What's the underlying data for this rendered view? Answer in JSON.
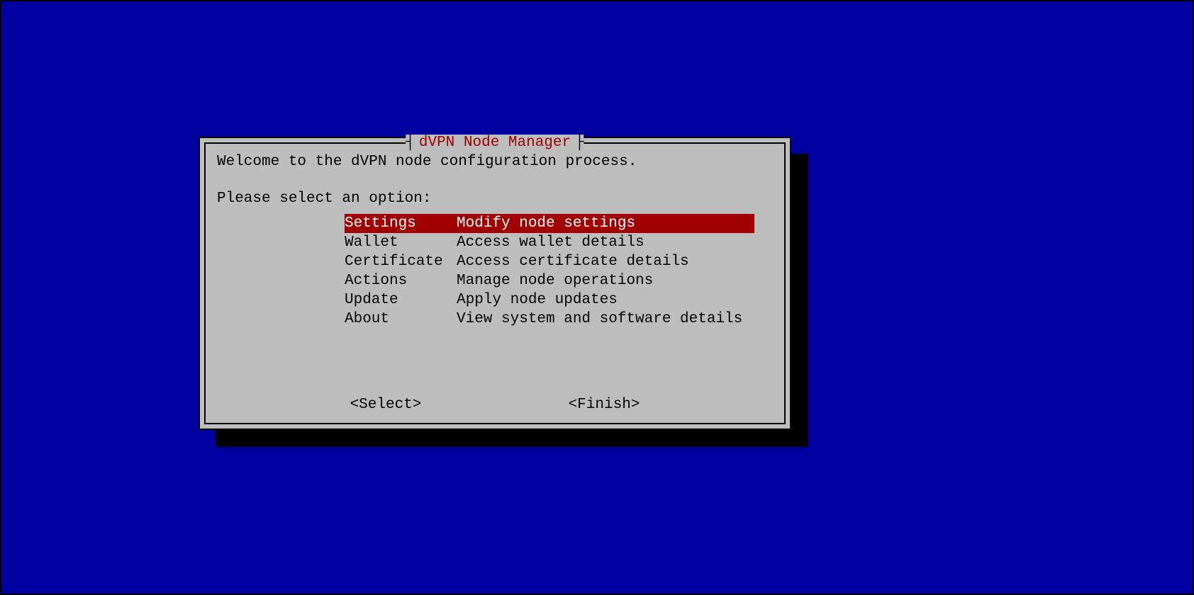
{
  "dialog": {
    "title": "dVPN Node Manager",
    "welcome": "Welcome to the dVPN node configuration process.",
    "prompt": "Please select an option:",
    "menu": [
      {
        "key": "Settings",
        "desc": "Modify node settings",
        "selected": true
      },
      {
        "key": "Wallet",
        "desc": "Access wallet details",
        "selected": false
      },
      {
        "key": "Certificate",
        "desc": "Access certificate details",
        "selected": false
      },
      {
        "key": "Actions",
        "desc": "Manage node operations",
        "selected": false
      },
      {
        "key": "Update",
        "desc": "Apply node updates",
        "selected": false
      },
      {
        "key": "About",
        "desc": "View system and software details",
        "selected": false
      }
    ],
    "buttons": {
      "select": "<Select>",
      "finish": "<Finish>"
    },
    "title_brackets": {
      "left": "┤",
      "right": "├"
    }
  }
}
